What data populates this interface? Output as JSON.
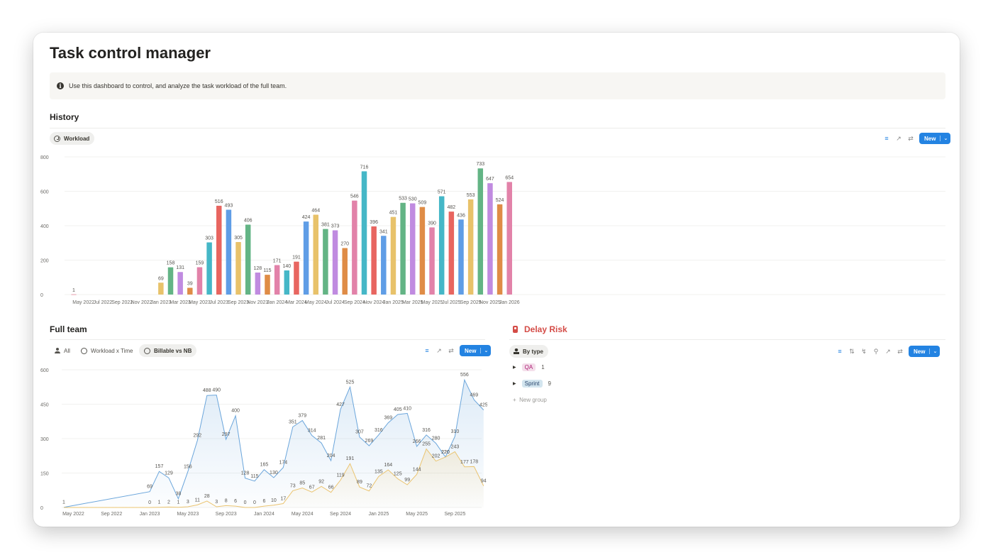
{
  "page": {
    "title": "Task control manager",
    "callout_text": "Use this dashboard to control, and analyze the task workload of the full team."
  },
  "history": {
    "heading": "History",
    "view_label": "Workload",
    "new_label": "New"
  },
  "full_team": {
    "heading": "Full team",
    "tabs": [
      {
        "label": "All",
        "icon": "person-icon"
      },
      {
        "label": "Workload x Time",
        "icon": "clock-icon"
      },
      {
        "label": "Billable vs NB",
        "icon": "clock-icon"
      }
    ],
    "new_label": "New"
  },
  "delay_risk": {
    "heading": "Delay Risk",
    "view_label": "By type",
    "new_label": "New",
    "groups": [
      {
        "tag": "QA",
        "count": "1",
        "tag_bg": "#f4dfeb",
        "tag_color": "#ad1a72"
      },
      {
        "tag": "Sprint",
        "count": "9",
        "tag_bg": "#d3e5ef",
        "tag_color": "#28456c"
      }
    ],
    "new_group_label": "New group"
  },
  "chart_data": [
    {
      "type": "bar",
      "title": "",
      "ylim": [
        0,
        800
      ],
      "yticks": [
        "0",
        "200",
        "400",
        "600",
        "800"
      ],
      "xtick_labels": [
        "May 2022",
        "Jul 2022",
        "Sep 2022",
        "Nov 2022",
        "Jan 2023",
        "Mar 2023",
        "May 2023",
        "Jul 2023",
        "Sep 2023",
        "Nov 2023",
        "Jan 2024",
        "Mar 2024",
        "May 2024",
        "Jul 2024",
        "Sep 2024",
        "Nov 2024",
        "Jan 2025",
        "Mar 2025",
        "May 2025",
        "Jul 2025",
        "Sep 2025",
        "Nov 2025",
        "Jan 2026"
      ],
      "grid": true,
      "bars": [
        {
          "x": "Apr 2022",
          "value": 1,
          "label": "1",
          "color": "#e06d82"
        },
        {
          "x": "Jan 2023",
          "value": 69,
          "label": "69",
          "color": "#e8c26a"
        },
        {
          "x": "Feb 2023",
          "value": 158,
          "label": "158",
          "color": "#63b485"
        },
        {
          "x": "Mar 2023",
          "value": 131,
          "label": "131",
          "color": "#c08be0"
        },
        {
          "x": "Apr 2023",
          "value": 39,
          "label": "39",
          "color": "#df8c46"
        },
        {
          "x": "May 2023",
          "value": 159,
          "label": "159",
          "color": "#e282a9"
        },
        {
          "x": "Jun 2023",
          "value": 303,
          "label": "303",
          "color": "#45b7c7"
        },
        {
          "x": "Jul 2023",
          "value": 516,
          "label": "516",
          "color": "#e86560"
        },
        {
          "x": "Aug 2023",
          "value": 493,
          "label": "493",
          "color": "#5f9de6"
        },
        {
          "x": "Sep 2023",
          "value": 305,
          "label": "305",
          "color": "#e8c26a"
        },
        {
          "x": "Oct 2023",
          "value": 406,
          "label": "406",
          "color": "#63b485"
        },
        {
          "x": "Nov 2023",
          "value": 128,
          "label": "128",
          "color": "#c08be0"
        },
        {
          "x": "Dec 2023",
          "value": 115,
          "label": "115",
          "color": "#df8c46"
        },
        {
          "x": "Jan 2024",
          "value": 171,
          "label": "171",
          "color": "#e282a9"
        },
        {
          "x": "Feb 2024",
          "value": 140,
          "label": "140",
          "color": "#45b7c7"
        },
        {
          "x": "Mar 2024",
          "value": 191,
          "label": "191",
          "color": "#e86560"
        },
        {
          "x": "Apr 2024",
          "value": 424,
          "label": "424",
          "color": "#5f9de6"
        },
        {
          "x": "May 2024",
          "value": 464,
          "label": "464",
          "color": "#e8c26a"
        },
        {
          "x": "Jun 2024",
          "value": 381,
          "label": "381",
          "color": "#63b485"
        },
        {
          "x": "Jul 2024",
          "value": 373,
          "label": "373",
          "color": "#c08be0"
        },
        {
          "x": "Aug 2024",
          "value": 270,
          "label": "270",
          "color": "#df8c46"
        },
        {
          "x": "Sep 2024",
          "value": 546,
          "label": "546",
          "color": "#e282a9"
        },
        {
          "x": "Oct 2024",
          "value": 716,
          "label": "716",
          "color": "#45b7c7"
        },
        {
          "x": "Nov 2024",
          "value": 396,
          "label": "396",
          "color": "#e86560"
        },
        {
          "x": "Dec 2024",
          "value": 341,
          "label": "341",
          "color": "#5f9de6"
        },
        {
          "x": "Jan 2025",
          "value": 451,
          "label": "451",
          "color": "#e8c26a"
        },
        {
          "x": "Feb 2025",
          "value": 533,
          "label": "533",
          "color": "#63b485"
        },
        {
          "x": "Mar 2025",
          "value": 530,
          "label": "530",
          "color": "#c08be0"
        },
        {
          "x": "Apr 2025",
          "value": 509,
          "label": "509",
          "color": "#df8c46"
        },
        {
          "x": "May 2025",
          "value": 390,
          "label": "390",
          "color": "#e282a9"
        },
        {
          "x": "Jun 2025",
          "value": 571,
          "label": "571",
          "color": "#45b7c7"
        },
        {
          "x": "Jul 2025",
          "value": 482,
          "label": "482",
          "color": "#e86560"
        },
        {
          "x": "Aug 2025",
          "value": 436,
          "label": "436",
          "color": "#5f9de6"
        },
        {
          "x": "Sep 2025",
          "value": 553,
          "label": "553",
          "color": "#e8c26a"
        },
        {
          "x": "Oct 2025",
          "value": 733,
          "label": "733",
          "color": "#63b485"
        },
        {
          "x": "Nov 2025",
          "value": 647,
          "label": "647",
          "color": "#c08be0"
        },
        {
          "x": "Dec 2025",
          "value": 524,
          "label": "524",
          "color": "#df8c46"
        },
        {
          "x": "Jan 2026",
          "value": 654,
          "label": "654",
          "color": "#e282a9"
        }
      ]
    },
    {
      "type": "area",
      "title": "",
      "ylim": [
        0,
        600
      ],
      "yticks": [
        "0",
        "150",
        "300",
        "450",
        "600"
      ],
      "xtick_labels": [
        "May 2022",
        "Sep 2022",
        "Jan 2023",
        "May 2023",
        "Sep 2023",
        "Jan 2024",
        "May 2024",
        "Sep 2024",
        "Jan 2025",
        "May 2025",
        "Sep 2025"
      ],
      "grid": true,
      "x": [
        "Apr 2022",
        "Jan 2023",
        "Feb 2023",
        "Mar 2023",
        "Apr 2023",
        "May 2023",
        "Jun 2023",
        "Jul 2023",
        "Aug 2023",
        "Sep 2023",
        "Oct 2023",
        "Nov 2023",
        "Dec 2023",
        "Jan 2024",
        "Feb 2024",
        "Mar 2024",
        "Apr 2024",
        "May 2024",
        "Jun 2024",
        "Jul 2024",
        "Aug 2024",
        "Sep 2024",
        "Oct 2024",
        "Nov 2024",
        "Dec 2024",
        "Jan 2025",
        "Feb 2025",
        "Mar 2025",
        "Apr 2025",
        "May 2025",
        "Jun 2025",
        "Jul 2025",
        "Aug 2025",
        "Sep 2025",
        "Oct 2025",
        "Nov 2025",
        "Dec 2025"
      ],
      "series": [
        {
          "color": "#6aa5db",
          "values": [
            1,
            69,
            157,
            129,
            38,
            156,
            292,
            488,
            490,
            297,
            400,
            128,
            115,
            165,
            130,
            174,
            351,
            379,
            314,
            281,
            204,
            427,
            525,
            307,
            269,
            316,
            369,
            405,
            410,
            266,
            316,
            280,
            220,
            310,
            556,
            469,
            425
          ],
          "labels": [
            "1",
            "69",
            "157",
            "129",
            "38",
            "156",
            "292",
            "488",
            "490",
            "297",
            "400",
            "128",
            "115",
            "165",
            "130",
            "174",
            "351",
            "379",
            "314",
            "281",
            "204",
            "427",
            "525",
            "307",
            "269",
            "316",
            "369",
            "405",
            "410",
            "266",
            "316",
            "280",
            "220",
            "310",
            "556",
            "469",
            "425"
          ]
        },
        {
          "color": "#ebc470",
          "values": [
            0,
            0,
            1,
            2,
            1,
            3,
            11,
            28,
            3,
            8,
            6,
            0,
            0,
            6,
            10,
            17,
            73,
            85,
            67,
            92,
            66,
            119,
            191,
            89,
            72,
            135,
            164,
            125,
            99,
            144,
            255,
            202,
            220,
            243,
            177,
            178,
            94
          ],
          "labels": [
            "",
            "0",
            "1",
            "2",
            "1",
            "3",
            "11",
            "28",
            "3",
            "8",
            "6",
            "0",
            "0",
            "6",
            "10",
            "17",
            "73",
            "85",
            "67",
            "92",
            "66",
            "119",
            "191",
            "89",
            "72",
            "135",
            "164",
            "125",
            "99",
            "144",
            "255",
            "202",
            "220",
            "243",
            "177",
            "178",
            "94"
          ]
        }
      ]
    }
  ]
}
